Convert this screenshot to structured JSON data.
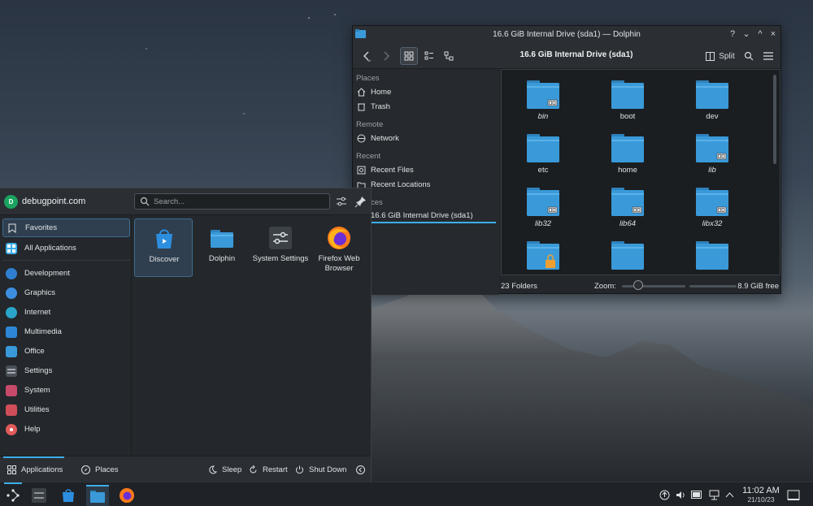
{
  "dolphin": {
    "window_title": "16.6 GiB Internal Drive (sda1) — Dolphin",
    "path": "16.6 GiB Internal Drive (sda1)",
    "split_label": "Split",
    "window_controls": [
      "?",
      "⌄",
      "^",
      "×"
    ],
    "places": {
      "section_places": "Places",
      "home": "Home",
      "trash": "Trash",
      "section_remote": "Remote",
      "network": "Network",
      "section_recent": "Recent",
      "recent_files": "Recent Files",
      "recent_locations": "Recent Locations",
      "section_devices_partial": "ces",
      "drive": "16.6 GiB Internal Drive (sda1)"
    },
    "files": [
      {
        "name": "bin",
        "italic": true,
        "badge": "link"
      },
      {
        "name": "boot",
        "italic": false,
        "badge": ""
      },
      {
        "name": "dev",
        "italic": false,
        "badge": ""
      },
      {
        "name": "etc",
        "italic": false,
        "badge": ""
      },
      {
        "name": "home",
        "italic": false,
        "badge": ""
      },
      {
        "name": "lib",
        "italic": true,
        "badge": "link"
      },
      {
        "name": "lib32",
        "italic": true,
        "badge": "link"
      },
      {
        "name": "lib64",
        "italic": true,
        "badge": "link"
      },
      {
        "name": "libx32",
        "italic": true,
        "badge": "link"
      },
      {
        "name": "",
        "italic": false,
        "badge": "lock"
      },
      {
        "name": "",
        "italic": false,
        "badge": ""
      },
      {
        "name": "",
        "italic": false,
        "badge": ""
      }
    ],
    "status": {
      "folder_count": "23 Folders",
      "zoom_label": "Zoom:",
      "free_space": "8.9 GiB free"
    }
  },
  "launcher": {
    "avatar_letter": "D",
    "username": "debugpoint.com",
    "search_placeholder": "Search...",
    "categories": {
      "favorites": "Favorites",
      "all_applications": "All Applications",
      "development": "Development",
      "graphics": "Graphics",
      "internet": "Internet",
      "multimedia": "Multimedia",
      "office": "Office",
      "settings": "Settings",
      "system": "System",
      "utilities": "Utilities",
      "help": "Help"
    },
    "apps": {
      "discover": "Discover",
      "dolphin": "Dolphin",
      "system_settings": "System Settings",
      "firefox": "Firefox Web Browser"
    },
    "footer": {
      "applications": "Applications",
      "places": "Places",
      "sleep": "Sleep",
      "restart": "Restart",
      "shutdown": "Shut Down"
    }
  },
  "panel": {
    "time": "11:02 AM",
    "date": "21/10/23"
  },
  "colors": {
    "accent": "#3daee9",
    "folder": "#3a9ad9",
    "folder_tab": "#2f82bd"
  }
}
